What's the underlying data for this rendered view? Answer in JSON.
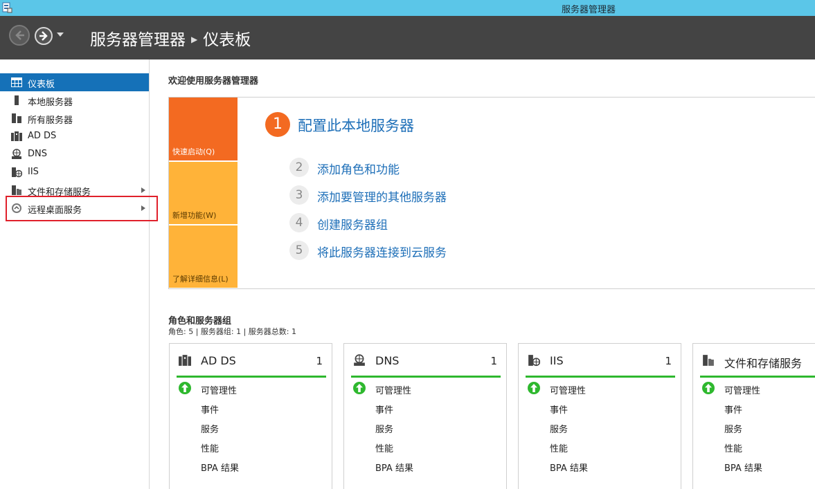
{
  "window": {
    "title": "服务器管理器"
  },
  "header": {
    "app": "服务器管理器",
    "page": "仪表板"
  },
  "sidebar": {
    "items": [
      {
        "label": "仪表板",
        "icon": "dashboard-icon",
        "active": true,
        "arrow": false
      },
      {
        "label": "本地服务器",
        "icon": "local-server-icon",
        "active": false,
        "arrow": false
      },
      {
        "label": "所有服务器",
        "icon": "all-servers-icon",
        "active": false,
        "arrow": false
      },
      {
        "label": "AD DS",
        "icon": "ad-ds-icon",
        "active": false,
        "arrow": false
      },
      {
        "label": "DNS",
        "icon": "dns-icon",
        "active": false,
        "arrow": false
      },
      {
        "label": "IIS",
        "icon": "iis-icon",
        "active": false,
        "arrow": false
      },
      {
        "label": "文件和存储服务",
        "icon": "file-storage-icon",
        "active": false,
        "arrow": true
      },
      {
        "label": "远程桌面服务",
        "icon": "remote-desktop-icon",
        "active": false,
        "arrow": true
      }
    ]
  },
  "welcome": {
    "title": "欢迎使用服务器管理器",
    "tiles": [
      "快速启动(Q)",
      "新增功能(W)",
      "了解详细信息(L)"
    ],
    "steps": [
      {
        "num": "1",
        "label": "配置此本地服务器"
      },
      {
        "num": "2",
        "label": "添加角色和功能"
      },
      {
        "num": "3",
        "label": "添加要管理的其他服务器"
      },
      {
        "num": "4",
        "label": "创建服务器组"
      },
      {
        "num": "5",
        "label": "将此服务器连接到云服务"
      }
    ]
  },
  "roles": {
    "title": "角色和服务器组",
    "subtitle": "角色: 5 | 服务器组: 1 | 服务器总数: 1",
    "cards": [
      {
        "name": "AD DS",
        "count": "1",
        "icon": "ad-ds-icon"
      },
      {
        "name": "DNS",
        "count": "1",
        "icon": "dns-icon"
      },
      {
        "name": "IIS",
        "count": "1",
        "icon": "iis-icon"
      },
      {
        "name": "文件和存储服务",
        "count": "",
        "icon": "file-storage-icon"
      }
    ],
    "rows": [
      "可管理性",
      "事件",
      "服务",
      "性能",
      "BPA 结果"
    ]
  },
  "colors": {
    "accent": "#1571b8",
    "header": "#444444",
    "titlebar": "#5bc6e8",
    "quickstart": "#f36a21",
    "tile": "#ffb339",
    "ok": "#2eb82e"
  }
}
